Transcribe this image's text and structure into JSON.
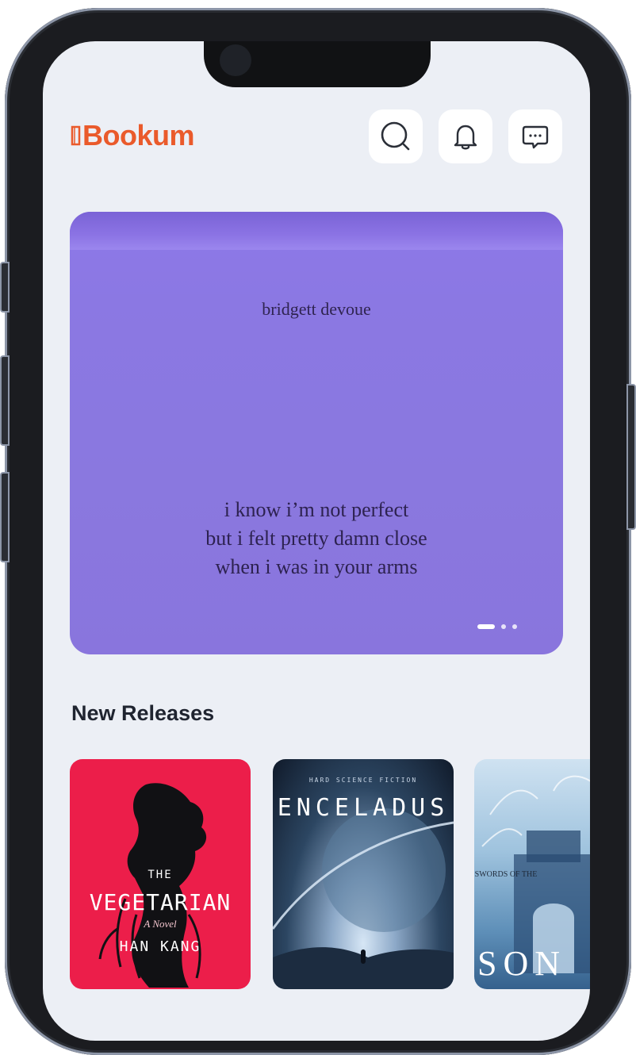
{
  "app": {
    "name": "Bookum",
    "brand_color": "#ea5a2b"
  },
  "header": {
    "icons": [
      "search-icon",
      "bell-icon",
      "chat-icon"
    ]
  },
  "hero": {
    "author": "bridgett devoue",
    "quote_lines": [
      "i know i’m not perfect",
      "but i felt pretty damn close",
      "when i was in your arms"
    ],
    "slides": 3,
    "active_slide": 1
  },
  "new_releases": {
    "title": "New Releases",
    "books": [
      {
        "title_top": "THE",
        "title": "VEGETARIAN",
        "subtitle": "A Novel",
        "author": "HAN KANG"
      },
      {
        "kicker": "HARD SCIENCE FICTION",
        "title": "ENCELADUS"
      },
      {
        "title_small": "SWORDS OF THE",
        "title": "SON"
      }
    ]
  }
}
